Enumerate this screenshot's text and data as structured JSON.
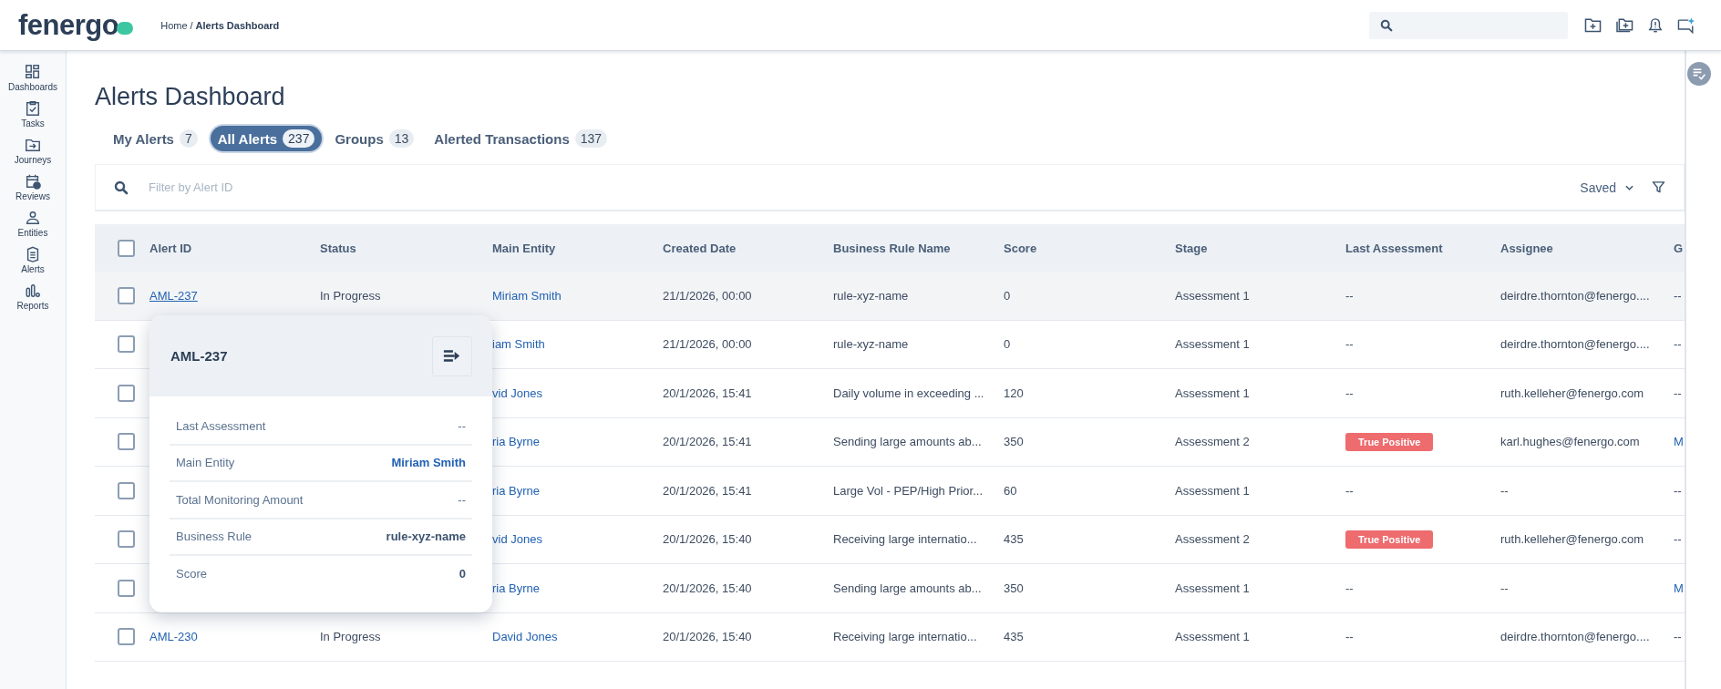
{
  "topbar": {
    "logo": "fenergo",
    "breadcrumb": {
      "parent": "Home",
      "separator": "/",
      "current": "Alerts Dashboard"
    },
    "icons": [
      {
        "kind": "folder-plus"
      },
      {
        "kind": "folders-plus"
      },
      {
        "kind": "bell"
      },
      {
        "kind": "message"
      }
    ]
  },
  "sidebar": {
    "items": [
      {
        "label": "Dashboards",
        "kind": "dashboards"
      },
      {
        "label": "Tasks",
        "kind": "tasks"
      },
      {
        "label": "Journeys",
        "kind": "journeys"
      },
      {
        "label": "Reviews",
        "kind": "reviews"
      },
      {
        "label": "Entities",
        "kind": "entities"
      },
      {
        "label": "Alerts",
        "kind": "alerts"
      },
      {
        "label": "Reports",
        "kind": "reports"
      }
    ]
  },
  "page_title": "Alerts Dashboard",
  "tabs": [
    {
      "label": "My Alerts",
      "count": "7",
      "selected": false
    },
    {
      "label": "All Alerts",
      "count": "237",
      "selected": true
    },
    {
      "label": "Groups",
      "count": "13",
      "selected": false
    },
    {
      "label": "Alerted Transactions",
      "count": "137",
      "selected": false
    }
  ],
  "filter": {
    "placeholder": "Filter by Alert ID",
    "saved": "Saved"
  },
  "table": {
    "select_all_checked": false,
    "columns": [
      "Alert ID",
      "Status",
      "Main Entity",
      "Created Date",
      "Business Rule Name",
      "Score",
      "Stage",
      "Last Assessment",
      "Assignee",
      "G"
    ],
    "rows": [
      {
        "checked": false,
        "hovered": true,
        "alert_id": "AML-237",
        "status": "In Progress",
        "main_entity": "Miriam Smith",
        "created_date": "21/1/2026, 00:00",
        "business_rule": "rule-xyz-name",
        "score": "0",
        "stage": "Assessment 1",
        "last_assessment": {
          "kind": "text",
          "text": "--"
        },
        "assignee": "deirdre.thornton@fenergo....",
        "column_10": {
          "text": "--",
          "link": false
        }
      },
      {
        "checked": false,
        "hovered": false,
        "main_entity": "iam Smith",
        "created_date": "21/1/2026, 00:00",
        "business_rule": "rule-xyz-name",
        "score": "0",
        "stage": "Assessment 1",
        "last_assessment": {
          "kind": "text",
          "text": "--"
        },
        "assignee": "deirdre.thornton@fenergo....",
        "column_10": {
          "text": "--",
          "link": false
        }
      },
      {
        "checked": false,
        "hovered": false,
        "main_entity": "vid Jones",
        "created_date": "20/1/2026, 15:41",
        "business_rule": "Daily volume in exceeding ...",
        "score": "120",
        "stage": "Assessment 1",
        "last_assessment": {
          "kind": "text",
          "text": "--"
        },
        "assignee": "ruth.kelleher@fenergo.com",
        "column_10": {
          "text": "--",
          "link": false
        }
      },
      {
        "checked": false,
        "hovered": false,
        "main_entity": "ria Byrne",
        "created_date": "20/1/2026, 15:41",
        "business_rule": "Sending large amounts ab...",
        "score": "350",
        "stage": "Assessment 2",
        "last_assessment": {
          "kind": "badge",
          "text": "True Positive"
        },
        "assignee": "karl.hughes@fenergo.com",
        "column_10": {
          "text": "M",
          "link": true
        }
      },
      {
        "checked": false,
        "hovered": false,
        "main_entity": "ria Byrne",
        "created_date": "20/1/2026, 15:41",
        "business_rule": "Large Vol - PEP/High Prior...",
        "score": "60",
        "stage": "Assessment 1",
        "last_assessment": {
          "kind": "text",
          "text": "--"
        },
        "assignee": "--",
        "column_10": {
          "text": "--",
          "link": false
        }
      },
      {
        "checked": false,
        "hovered": false,
        "main_entity": "vid Jones",
        "created_date": "20/1/2026, 15:40",
        "business_rule": "Receiving large internatio...",
        "score": "435",
        "stage": "Assessment 2",
        "last_assessment": {
          "kind": "badge",
          "text": "True Positive"
        },
        "assignee": "ruth.kelleher@fenergo.com",
        "column_10": {
          "text": "--",
          "link": false
        }
      },
      {
        "checked": false,
        "hovered": false,
        "main_entity": "ria Byrne",
        "created_date": "20/1/2026, 15:40",
        "business_rule": "Sending large amounts ab...",
        "score": "350",
        "stage": "Assessment 1",
        "last_assessment": {
          "kind": "text",
          "text": "--"
        },
        "assignee": "--",
        "column_10": {
          "text": "M",
          "link": true
        }
      },
      {
        "checked": false,
        "hovered": false,
        "alert_id": "AML-230",
        "status": "In Progress",
        "main_entity": "David Jones",
        "created_date": "20/1/2026, 15:40",
        "business_rule": "Receiving large internatio...",
        "score": "435",
        "stage": "Assessment 1",
        "last_assessment": {
          "kind": "text",
          "text": "--"
        },
        "assignee": "deirdre.thornton@fenergo....",
        "column_10": {
          "text": "--",
          "link": false
        }
      }
    ]
  },
  "popover": {
    "title": "AML-237",
    "fields": [
      {
        "label": "Last Assessment",
        "value": "--",
        "kind": "empty"
      },
      {
        "label": "Main Entity",
        "value": "Miriam Smith",
        "kind": "link"
      },
      {
        "label": "Total Monitoring Amount",
        "value": "--",
        "kind": "empty"
      },
      {
        "label": "Business Rule",
        "value": "rule-xyz-name",
        "kind": "bold"
      },
      {
        "label": "Score",
        "value": "0",
        "kind": "bold"
      }
    ]
  }
}
